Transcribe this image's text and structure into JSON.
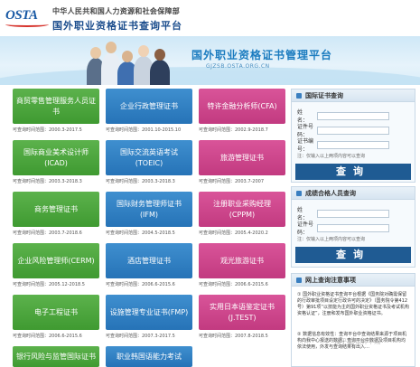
{
  "header": {
    "logo": "OSTA",
    "ministry": "中华人民共和国人力资源和社会保障部",
    "site_title": "国外职业资格证书查询平台"
  },
  "banner": {
    "title": "国外职业资格证书管理平台",
    "url": "GJZSB.OSTA.ORG.CN"
  },
  "tiles": [
    {
      "label": "商贸零售管理服务人员证书",
      "range": "可查询时间范围：2000.3-2017.5",
      "color": "green"
    },
    {
      "label": "企业行政管理证书",
      "range": "可查询时间范围：2001.10-2015.10",
      "color": "blue"
    },
    {
      "label": "特许金融分析师(CFA)",
      "range": "可查询时间范围：2002.9-2018.7",
      "color": "pink"
    },
    {
      "label": "国际商业美术设计师(ICAD)",
      "range": "可查询时间范围：2003.3-2018.3",
      "color": "green"
    },
    {
      "label": "国际交流英语考试(TOEIC)",
      "range": "可查询时间范围：2003.3-2018.3",
      "color": "blue"
    },
    {
      "label": "旅游管理证书",
      "range": "可查询时间范围：2003.7-2007",
      "color": "pink"
    },
    {
      "label": "商务管理证书",
      "range": "可查询时间范围：2003.7-2018.6",
      "color": "green"
    },
    {
      "label": "国际财务管理师证书(IFM)",
      "range": "可查询时间范围：2004.5-2018.5",
      "color": "blue"
    },
    {
      "label": "注册职业采购经理(CPPM)",
      "range": "可查询时间范围：2005.4-2020.2",
      "color": "pink"
    },
    {
      "label": "企业风险管理师(CERM)",
      "range": "可查询时间范围：2005.12-2018.5",
      "color": "green"
    },
    {
      "label": "酒店管理证书",
      "range": "可查询时间范围：2006.6-2015.6",
      "color": "blue"
    },
    {
      "label": "观光旅游证书",
      "range": "可查询时间范围：2006.6-2015.6",
      "color": "pink"
    },
    {
      "label": "电子工程证书",
      "range": "可查询时间范围：2006.6-2015.6",
      "color": "green"
    },
    {
      "label": "设施管理专业证书(FMP)",
      "range": "可查询时间范围：2007.3-2017.5",
      "color": "blue"
    },
    {
      "label": "实用日本语鉴定证书(J.TEST)",
      "range": "可查询时间范围：2007.8-2018.5",
      "color": "pink"
    },
    {
      "label": "银行风险与监管国际证书",
      "range": "",
      "color": "green"
    },
    {
      "label": "职业韩国语能力考试",
      "range": "",
      "color": "blue"
    }
  ],
  "panel": {
    "cert_query": {
      "title": "国际证书查询",
      "fields": [
        {
          "label": "姓　名：",
          "placeholder": ""
        },
        {
          "label": "证件号码：",
          "placeholder": ""
        },
        {
          "label": "证书编号：",
          "placeholder": ""
        }
      ],
      "note": "注：仅输入以上两项内容可以查询",
      "button": "查询"
    },
    "score_query": {
      "title": "成绩合格人员查询",
      "fields": [
        {
          "label": "姓　名：",
          "placeholder": ""
        },
        {
          "label": "证件号码：",
          "placeholder": ""
        }
      ],
      "note": "注：仅输入以上两项内容可以查询",
      "button": "查询"
    },
    "notice": {
      "title": "网上查询注意事项",
      "items": [
        "① 国外职业资格证书查询平台根据《国务院对确需保留的行政审批项目设定行政许可的决定》（国务院令第412号）第91项“以技能为主的国外职业资格证书及考试机构资格认证”，注册和发布国外职业资格证书。",
        "② 数据信息有效性：查询平台中查询结果来源于项目机构向我中心报送的数据，查询平台中数据及项目机构均依法使用，外发与查询结果有出入…"
      ]
    }
  },
  "watermark": "知乎 @以弈中观"
}
